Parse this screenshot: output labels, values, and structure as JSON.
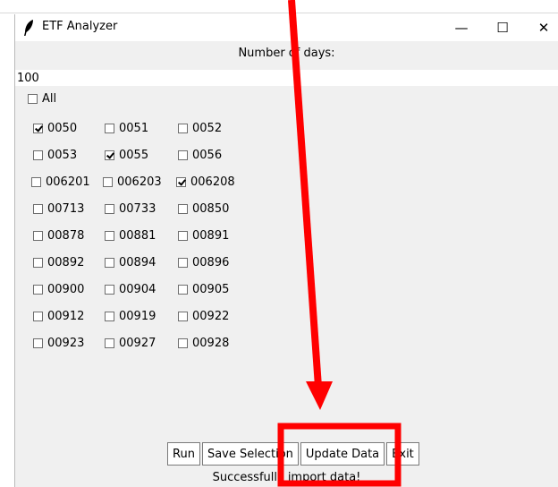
{
  "window": {
    "title": "ETF Analyzer",
    "minimize_glyph": "—",
    "maximize_glyph": "☐",
    "close_glyph": "✕"
  },
  "days": {
    "label": "Number of days:",
    "value": "100"
  },
  "all_checkbox": {
    "label": "All",
    "checked": false
  },
  "etfs": [
    {
      "label": "0050",
      "checked": true
    },
    {
      "label": "0051",
      "checked": false
    },
    {
      "label": "0052",
      "checked": false
    },
    {
      "label": "0053",
      "checked": false
    },
    {
      "label": "0055",
      "checked": true
    },
    {
      "label": "0056",
      "checked": false
    },
    {
      "label": "006201",
      "checked": false
    },
    {
      "label": "006203",
      "checked": false
    },
    {
      "label": "006208",
      "checked": true
    },
    {
      "label": "00713",
      "checked": false
    },
    {
      "label": "00733",
      "checked": false
    },
    {
      "label": "00850",
      "checked": false
    },
    {
      "label": "00878",
      "checked": false
    },
    {
      "label": "00881",
      "checked": false
    },
    {
      "label": "00891",
      "checked": false
    },
    {
      "label": "00892",
      "checked": false
    },
    {
      "label": "00894",
      "checked": false
    },
    {
      "label": "00896",
      "checked": false
    },
    {
      "label": "00900",
      "checked": false
    },
    {
      "label": "00904",
      "checked": false
    },
    {
      "label": "00905",
      "checked": false
    },
    {
      "label": "00912",
      "checked": false
    },
    {
      "label": "00919",
      "checked": false
    },
    {
      "label": "00922",
      "checked": false
    },
    {
      "label": "00923",
      "checked": false
    },
    {
      "label": "00927",
      "checked": false
    },
    {
      "label": "00928",
      "checked": false
    }
  ],
  "buttons": {
    "run": "Run",
    "save_selection": "Save Selection",
    "update_data": "Update Data",
    "exit": "Exit"
  },
  "status_text": "Successfully import data!",
  "annotation": {
    "color": "#ff0000"
  }
}
